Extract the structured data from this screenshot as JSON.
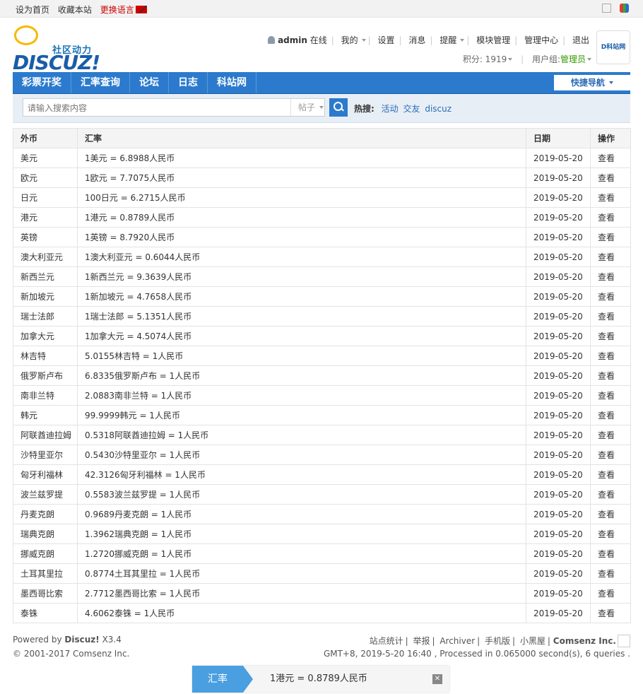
{
  "topbar": {
    "set_home": "设为首页",
    "bookmark": "收藏本站",
    "change_lang": "更换语言"
  },
  "logo": {
    "tagline": "社区动力",
    "brand": "DISCUZ!"
  },
  "user": {
    "name": "admin",
    "status": "在线",
    "menu": [
      "我的",
      "设置",
      "消息",
      "提醒",
      "模块管理",
      "管理中心",
      "退出"
    ],
    "points_label": "积分: 1919",
    "group_label": "用户组:",
    "group": "管理员"
  },
  "partner": "D科站网",
  "nav": {
    "items": [
      "彩票开奖",
      "汇率查询",
      "论坛",
      "日志",
      "科站网"
    ],
    "quick": "快捷导航"
  },
  "search": {
    "placeholder": "请输入搜索内容",
    "type": "帖子",
    "hot_label": "热搜:",
    "hot": [
      "活动",
      "交友",
      "discuz"
    ]
  },
  "table": {
    "headers": [
      "外币",
      "汇率",
      "日期",
      "操作"
    ],
    "rows": [
      [
        "美元",
        "1美元 = 6.8988人民币",
        "2019-05-20",
        "查看"
      ],
      [
        "欧元",
        "1欧元 = 7.7075人民币",
        "2019-05-20",
        "查看"
      ],
      [
        "日元",
        "100日元 = 6.2715人民币",
        "2019-05-20",
        "查看"
      ],
      [
        "港元",
        "1港元 = 0.8789人民币",
        "2019-05-20",
        "查看"
      ],
      [
        "英镑",
        "1英镑 = 8.7920人民币",
        "2019-05-20",
        "查看"
      ],
      [
        "澳大利亚元",
        "1澳大利亚元 = 0.6044人民币",
        "2019-05-20",
        "查看"
      ],
      [
        "新西兰元",
        "1新西兰元 = 9.3639人民币",
        "2019-05-20",
        "查看"
      ],
      [
        "新加坡元",
        "1新加坡元 = 4.7658人民币",
        "2019-05-20",
        "查看"
      ],
      [
        "瑞士法郎",
        "1瑞士法郎 = 5.1351人民币",
        "2019-05-20",
        "查看"
      ],
      [
        "加拿大元",
        "1加拿大元 = 4.5074人民币",
        "2019-05-20",
        "查看"
      ],
      [
        "林吉特",
        "5.0155林吉特 = 1人民币",
        "2019-05-20",
        "查看"
      ],
      [
        "俄罗斯卢布",
        "6.8335俄罗斯卢布 = 1人民币",
        "2019-05-20",
        "查看"
      ],
      [
        "南非兰特",
        "2.0883南非兰特 = 1人民币",
        "2019-05-20",
        "查看"
      ],
      [
        "韩元",
        "99.9999韩元 = 1人民币",
        "2019-05-20",
        "查看"
      ],
      [
        "阿联酋迪拉姆",
        "0.5318阿联酋迪拉姆 = 1人民币",
        "2019-05-20",
        "查看"
      ],
      [
        "沙特里亚尔",
        "0.5430沙特里亚尔 = 1人民币",
        "2019-05-20",
        "查看"
      ],
      [
        "匈牙利福林",
        "42.3126匈牙利福林 = 1人民币",
        "2019-05-20",
        "查看"
      ],
      [
        "波兰兹罗提",
        "0.5583波兰兹罗提 = 1人民币",
        "2019-05-20",
        "查看"
      ],
      [
        "丹麦克朗",
        "0.9689丹麦克朗 = 1人民币",
        "2019-05-20",
        "查看"
      ],
      [
        "瑞典克朗",
        "1.3962瑞典克朗 = 1人民币",
        "2019-05-20",
        "查看"
      ],
      [
        "挪威克朗",
        "1.2720挪威克朗 = 1人民币",
        "2019-05-20",
        "查看"
      ],
      [
        "土耳其里拉",
        "0.8774土耳其里拉 = 1人民币",
        "2019-05-20",
        "查看"
      ],
      [
        "墨西哥比索",
        "2.7712墨西哥比索 = 1人民币",
        "2019-05-20",
        "查看"
      ],
      [
        "泰铢",
        "4.6062泰铢 = 1人民币",
        "2019-05-20",
        "查看"
      ]
    ]
  },
  "footer": {
    "powered": "Powered by",
    "product": "Discuz!",
    "version": "X3.4",
    "copyright": "© 2001-2017 Comsenz Inc.",
    "links": [
      "站点统计",
      "举报",
      "Archiver",
      "手机版",
      "小黑屋"
    ],
    "company": "Comsenz Inc.",
    "timing": "GMT+8, 2019-5-20 16:40 , Processed in 0.065000 second(s), 6 queries ."
  },
  "toast": {
    "tag": "汇率",
    "message": "1港元 = 0.8789人民币"
  }
}
